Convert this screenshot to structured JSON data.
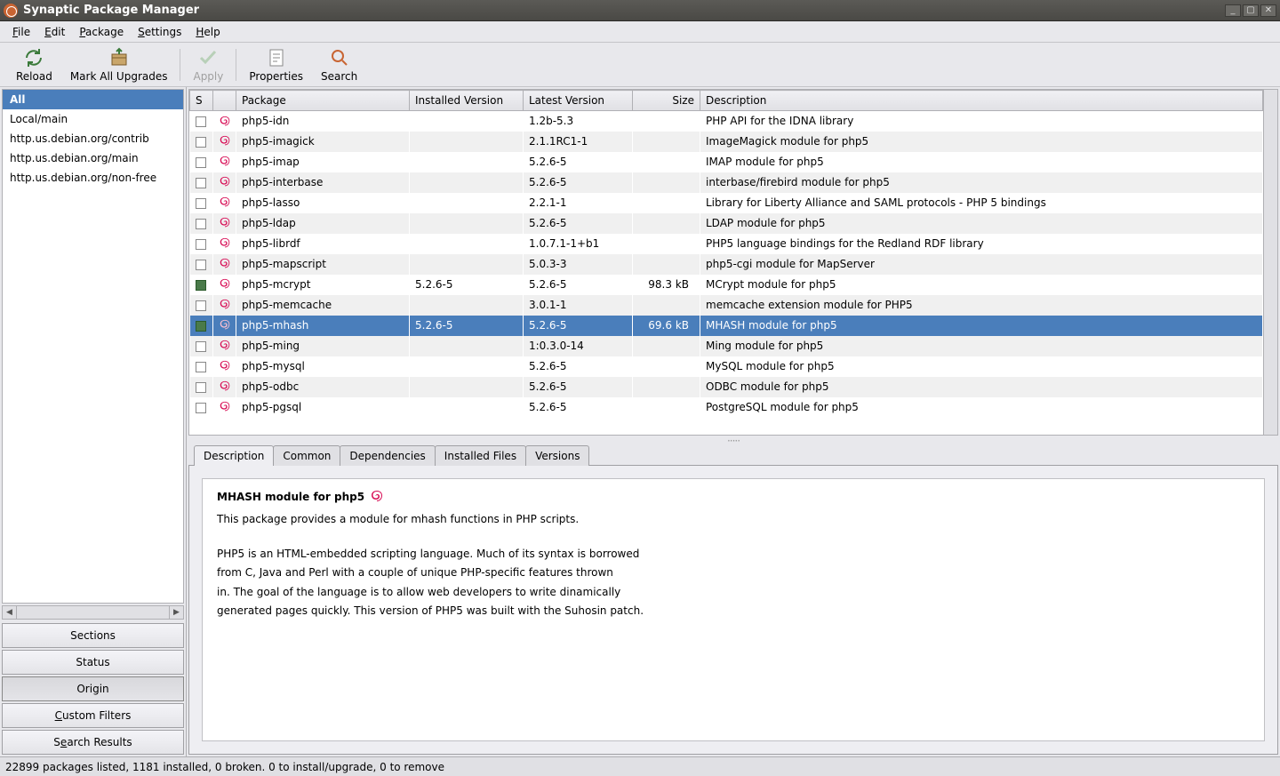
{
  "window": {
    "title": "Synaptic Package Manager"
  },
  "menubar": [
    {
      "label": "File",
      "u": "F"
    },
    {
      "label": "Edit",
      "u": "E"
    },
    {
      "label": "Package",
      "u": "P"
    },
    {
      "label": "Settings",
      "u": "S"
    },
    {
      "label": "Help",
      "u": "H"
    }
  ],
  "toolbar": {
    "reload": "Reload",
    "mark_all": "Mark All Upgrades",
    "apply": "Apply",
    "properties": "Properties",
    "search": "Search"
  },
  "sidebar": {
    "items": [
      {
        "label": "All",
        "selected": true
      },
      {
        "label": "Local/main"
      },
      {
        "label": "http.us.debian.org/contrib"
      },
      {
        "label": "http.us.debian.org/main"
      },
      {
        "label": "http.us.debian.org/non-free"
      }
    ],
    "buttons": {
      "sections": "Sections",
      "status": "Status",
      "origin": "Origin",
      "custom": "Custom Filters",
      "search": "Search Results"
    }
  },
  "table": {
    "headers": {
      "s": "S",
      "package": "Package",
      "installed": "Installed Version",
      "latest": "Latest Version",
      "size": "Size",
      "desc": "Description"
    },
    "rows": [
      {
        "pkg": "php5-idn",
        "latest": "1.2b-5.3",
        "desc": "PHP API for the IDNA library"
      },
      {
        "pkg": "php5-imagick",
        "latest": "2.1.1RC1-1",
        "desc": "ImageMagick module for php5"
      },
      {
        "pkg": "php5-imap",
        "latest": "5.2.6-5",
        "desc": "IMAP module for php5"
      },
      {
        "pkg": "php5-interbase",
        "latest": "5.2.6-5",
        "desc": "interbase/firebird module for php5"
      },
      {
        "pkg": "php5-lasso",
        "latest": "2.2.1-1",
        "desc": "Library for Liberty Alliance and SAML protocols - PHP 5 bindings"
      },
      {
        "pkg": "php5-ldap",
        "latest": "5.2.6-5",
        "desc": "LDAP module for php5"
      },
      {
        "pkg": "php5-librdf",
        "latest": "1.0.7.1-1+b1",
        "desc": "PHP5 language bindings for the Redland RDF library"
      },
      {
        "pkg": "php5-mapscript",
        "latest": "5.0.3-3",
        "desc": "php5-cgi module for MapServer"
      },
      {
        "pkg": "php5-mcrypt",
        "installed": "5.2.6-5",
        "latest": "5.2.6-5",
        "size": "98.3 kB",
        "desc": "MCrypt module for php5",
        "marked": true
      },
      {
        "pkg": "php5-memcache",
        "latest": "3.0.1-1",
        "desc": "memcache extension module for PHP5"
      },
      {
        "pkg": "php5-mhash",
        "installed": "5.2.6-5",
        "latest": "5.2.6-5",
        "size": "69.6 kB",
        "desc": "MHASH module for php5",
        "marked": true,
        "selected": true
      },
      {
        "pkg": "php5-ming",
        "latest": "1:0.3.0-14",
        "desc": "Ming module for php5"
      },
      {
        "pkg": "php5-mysql",
        "latest": "5.2.6-5",
        "desc": "MySQL module for php5"
      },
      {
        "pkg": "php5-odbc",
        "latest": "5.2.6-5",
        "desc": "ODBC module for php5"
      },
      {
        "pkg": "php5-pgsql",
        "latest": "5.2.6-5",
        "desc": "PostgreSQL module for php5"
      }
    ]
  },
  "detail": {
    "tabs": [
      "Description",
      "Common",
      "Dependencies",
      "Installed Files",
      "Versions"
    ],
    "title": "MHASH module for php5",
    "body": [
      "This package provides a module for mhash functions in PHP scripts.",
      "",
      "PHP5 is an HTML-embedded scripting language. Much of its syntax is borrowed",
      "from C, Java and Perl with a couple of unique PHP-specific features thrown",
      "in. The goal of the language is to allow web developers to write dinamically",
      "generated pages quickly. This version of PHP5 was built with the Suhosin patch."
    ]
  },
  "statusbar": "22899 packages listed, 1181 installed, 0 broken. 0 to install/upgrade, 0 to remove"
}
